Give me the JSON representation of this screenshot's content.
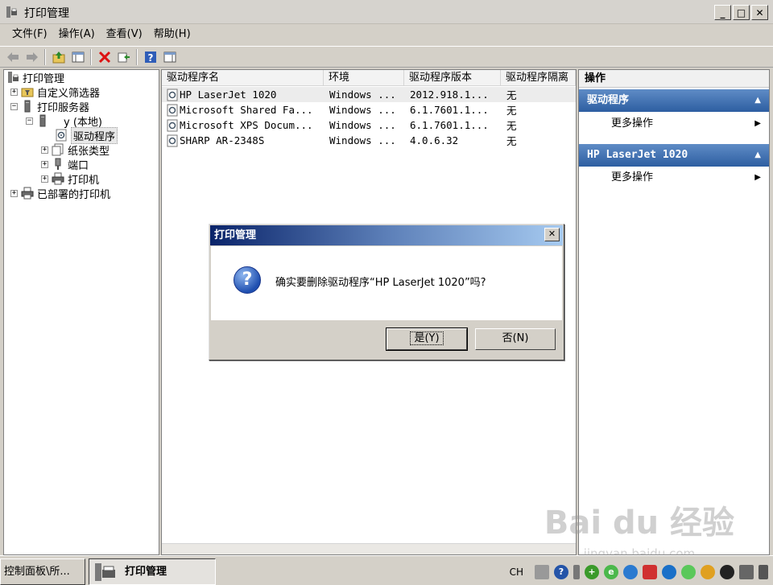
{
  "window": {
    "title": "打印管理"
  },
  "menu": [
    "文件(F)",
    "操作(A)",
    "查看(V)",
    "帮助(H)"
  ],
  "toolbar": {
    "buttons": [
      "back-icon",
      "forward-icon",
      "up-icon",
      "show-tree-icon",
      "delete-icon",
      "export-icon",
      "help-icon",
      "action-pane-icon"
    ]
  },
  "tree": {
    "items": [
      {
        "label": "打印管理",
        "icon": "print-management-icon",
        "expander": ""
      },
      {
        "label": "自定义筛选器",
        "icon": "filter-folder-icon",
        "expander": "+"
      },
      {
        "label": "打印服务器",
        "icon": "server-icon",
        "expander": "−"
      },
      {
        "label": "y (本地)",
        "icon": "server-icon",
        "expander": "−"
      },
      {
        "label": "驱动程序",
        "icon": "driver-icon",
        "expander": ""
      },
      {
        "label": "纸张类型",
        "icon": "forms-icon",
        "expander": "+"
      },
      {
        "label": "端口",
        "icon": "port-icon",
        "expander": "+"
      },
      {
        "label": "打印机",
        "icon": "printer-icon",
        "expander": "+"
      },
      {
        "label": "已部署的打印机",
        "icon": "printer-icon",
        "expander": "+"
      }
    ]
  },
  "list": {
    "columns": [
      "驱动程序名",
      "环境",
      "驱动程序版本",
      "驱动程序隔离"
    ],
    "rows": [
      [
        "HP LaserJet 1020",
        "Windows ...",
        "2012.918.1...",
        "无"
      ],
      [
        "Microsoft Shared Fa...",
        "Windows ...",
        "6.1.7601.1...",
        "无"
      ],
      [
        "Microsoft XPS Docum...",
        "Windows ...",
        "6.1.7601.1...",
        "无"
      ],
      [
        "SHARP AR-2348S",
        "Windows ...",
        "4.0.6.32",
        "无"
      ]
    ]
  },
  "actions": {
    "title": "操作",
    "groups": [
      {
        "label": "驱动程序",
        "item": "更多操作"
      },
      {
        "label": "HP LaserJet 1020",
        "item": "更多操作"
      }
    ]
  },
  "dialog": {
    "title": "打印管理",
    "message": "确实要删除驱动程序“HP LaserJet 1020”吗?",
    "yes_label": "是(Y)",
    "no_label": "否(N)",
    "close_glyph": "✕"
  },
  "taskbar": {
    "items": [
      "控制面板\\所...",
      "打印管理"
    ],
    "lang": "CH"
  },
  "watermark": {
    "brand": "Bai du 经验",
    "url": "jingyan.baidu.com"
  }
}
